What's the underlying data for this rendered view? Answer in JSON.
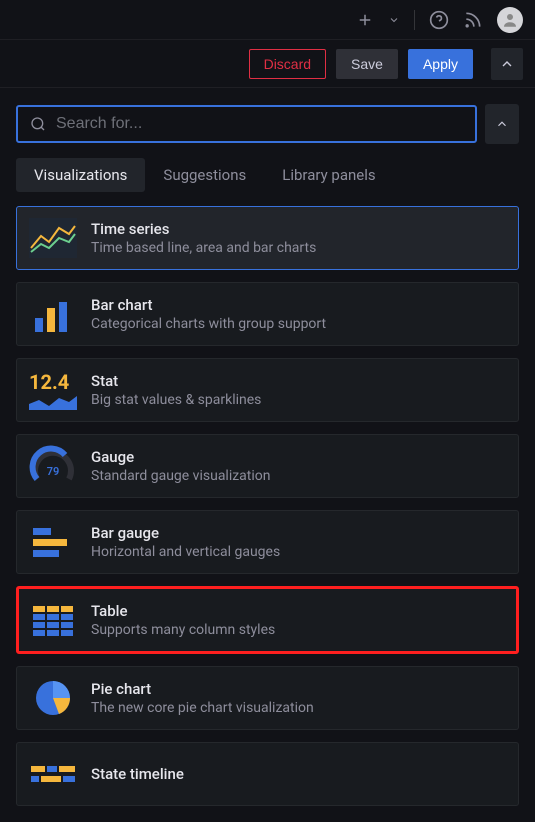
{
  "actions": {
    "discard": "Discard",
    "save": "Save",
    "apply": "Apply"
  },
  "search": {
    "placeholder": "Search for..."
  },
  "tabs": {
    "visualizations": "Visualizations",
    "suggestions": "Suggestions",
    "library": "Library panels"
  },
  "viz": [
    {
      "title": "Time series",
      "desc": "Time based line, area and bar charts"
    },
    {
      "title": "Bar chart",
      "desc": "Categorical charts with group support"
    },
    {
      "title": "Stat",
      "desc": "Big stat values & sparklines",
      "stat_value": "12.4"
    },
    {
      "title": "Gauge",
      "desc": "Standard gauge visualization",
      "gauge_value": "79"
    },
    {
      "title": "Bar gauge",
      "desc": "Horizontal and vertical gauges"
    },
    {
      "title": "Table",
      "desc": "Supports many column styles"
    },
    {
      "title": "Pie chart",
      "desc": "The new core pie chart visualization"
    },
    {
      "title": "State timeline",
      "desc": ""
    }
  ]
}
